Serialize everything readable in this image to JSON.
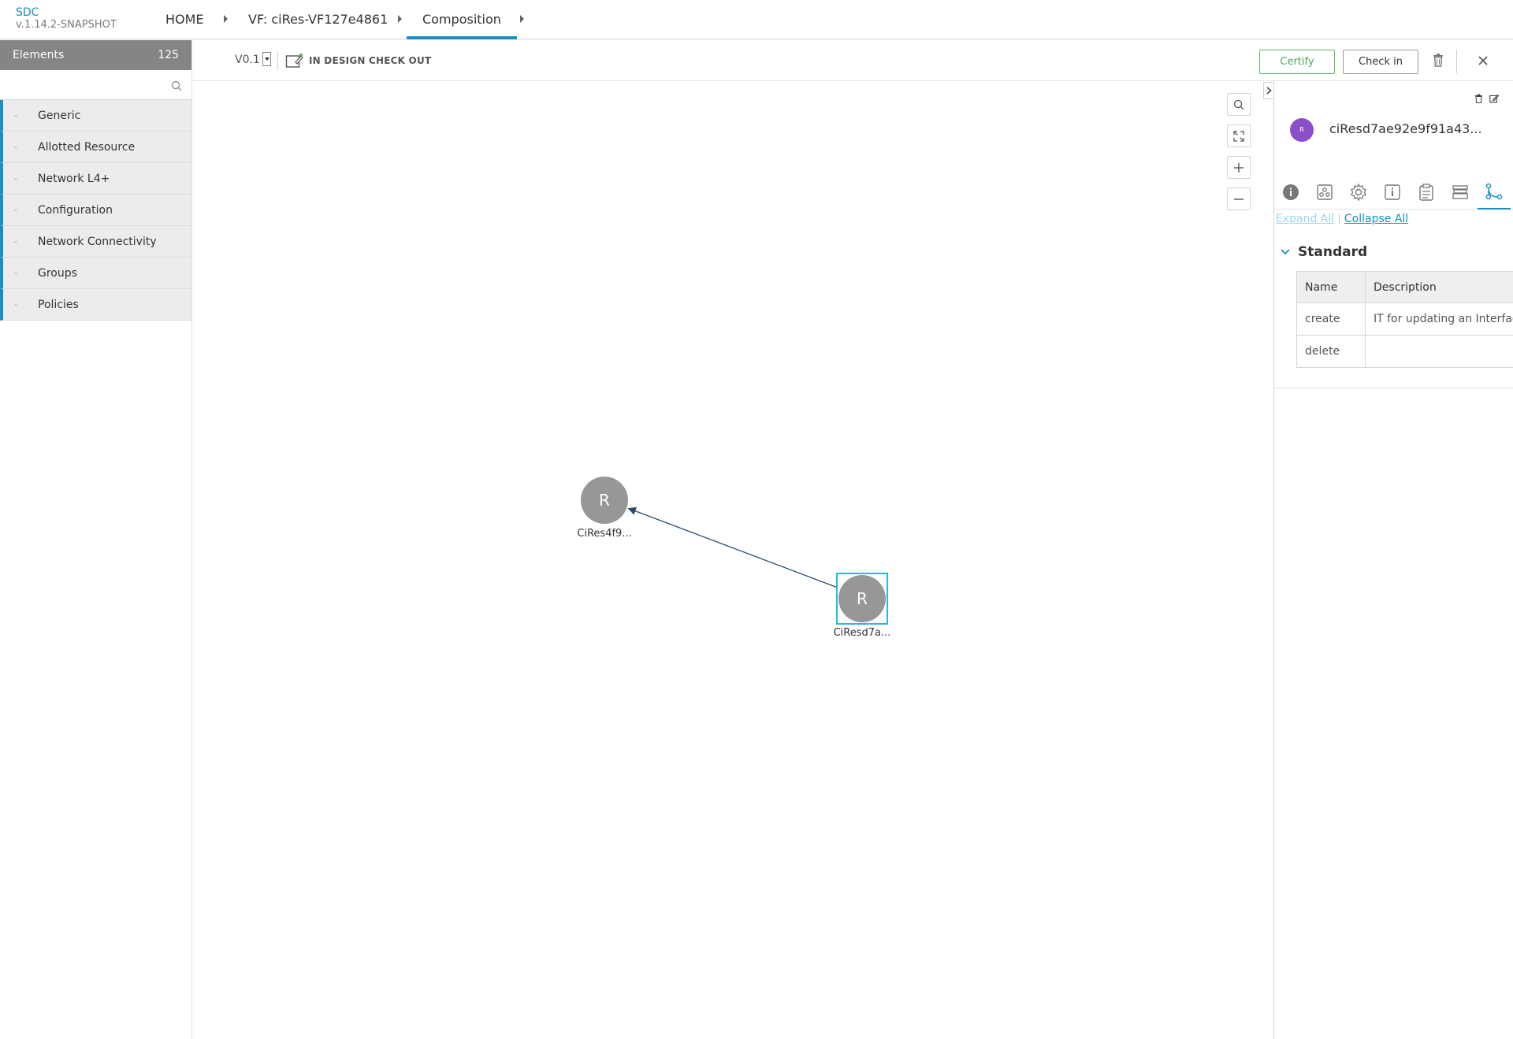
{
  "header": {
    "brand": "SDC",
    "version": "v.1.14.2-SNAPSHOT",
    "breadcrumbs": [
      {
        "label": "HOME"
      },
      {
        "label": "VF: ciRes-VF127e4861"
      },
      {
        "label": "Composition",
        "active": true
      }
    ]
  },
  "elements": {
    "title": "Elements",
    "count": "125",
    "search_placeholder": "",
    "categories": [
      "Generic",
      "Allotted Resource",
      "Network L4+",
      "Configuration",
      "Network Connectivity",
      "Groups",
      "Policies"
    ]
  },
  "toolbar": {
    "version": "V0.1",
    "status": "IN DESIGN CHECK OUT",
    "certify_label": "Certify",
    "checkin_label": "Check in"
  },
  "canvas": {
    "nodes": [
      {
        "letter": "R",
        "label": "CiRes4f9..."
      },
      {
        "letter": "R",
        "label": "CiResd7a...",
        "selected": true
      }
    ]
  },
  "right_panel": {
    "avatar_letter": "R",
    "title": "ciResd7ae92e9f91a43...",
    "expand_all": "Expand All",
    "collapse_all": "Collapse All",
    "section": "Standard",
    "table": {
      "headers": [
        "Name",
        "Description"
      ],
      "rows": [
        [
          "create",
          "IT for updating an Interface"
        ],
        [
          "delete",
          ""
        ]
      ]
    }
  },
  "colors": {
    "accent": "#1a8fc1",
    "certify": "#4aa85a",
    "node": "#979797",
    "selected": "#2bb7e4",
    "avatar": "#8a4fc9"
  }
}
